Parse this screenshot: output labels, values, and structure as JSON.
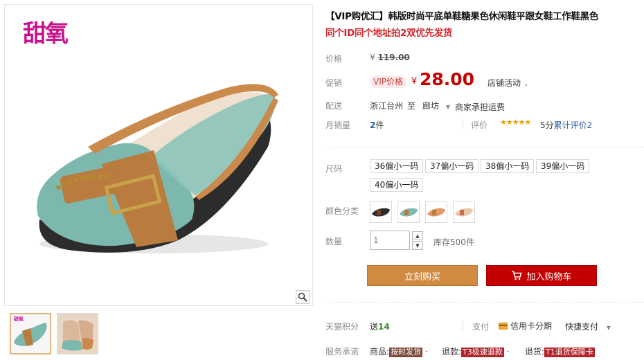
{
  "gallery": {
    "brand_logo": "甜氧",
    "thumb_mini_logo": "甜氧"
  },
  "product": {
    "title": "【VIP购优汇】韩版时尚平底单鞋糖果色休闲鞋平跟女鞋工作鞋黑色",
    "subtitle": "同个ID同个地址拍2双优先发货"
  },
  "price": {
    "label": "价格",
    "currency": "¥",
    "original": "119.00"
  },
  "promo": {
    "label": "促销",
    "badge": "VIP价格",
    "currency": "¥",
    "price": "28.00",
    "store_activity": "店铺活动"
  },
  "shipping": {
    "label": "配送",
    "from": "浙江台州",
    "to_label": "至",
    "dest": "廊坊",
    "fee": "商家承担运费"
  },
  "sales": {
    "label": "月销量",
    "count": "2",
    "unit": "件",
    "rating_label": "评价",
    "stars": "★★★★★",
    "rating_score": "5分",
    "rating_text": "累计评价2"
  },
  "size": {
    "label": "尺码",
    "options": [
      "36偏小一码",
      "37偏小一码",
      "38偏小一码",
      "39偏小一码",
      "40偏小一码"
    ]
  },
  "color": {
    "label": "颜色分类",
    "options": [
      {
        "name": "black",
        "hex": "#2a2a2a",
        "toe": "#7a3e22"
      },
      {
        "name": "teal",
        "hex": "#7fb8b0",
        "toe": "#b97b3e"
      },
      {
        "name": "orange",
        "hex": "#e39a6a",
        "toe": "#b97b3e"
      },
      {
        "name": "nude",
        "hex": "#e8c7a8",
        "toe": "#c66f4a"
      }
    ]
  },
  "quantity": {
    "label": "数量",
    "value": "1",
    "stock": "库存500件"
  },
  "buttons": {
    "buy_now": "立刻购买",
    "add_cart": "加入购物车"
  },
  "points": {
    "label": "天猫积分",
    "prefix": "送",
    "value": "14"
  },
  "payment": {
    "label": "支付",
    "credit": "信用卡分期",
    "quick": "快捷支付"
  },
  "service": {
    "label": "服务承诺",
    "goods_label": "商品:",
    "goods_badge": "按时发货",
    "refund_label": "退款:",
    "refund_badge": "T3极速退款",
    "return_label": "退货:",
    "return_badge": "T1退货保障卡"
  }
}
